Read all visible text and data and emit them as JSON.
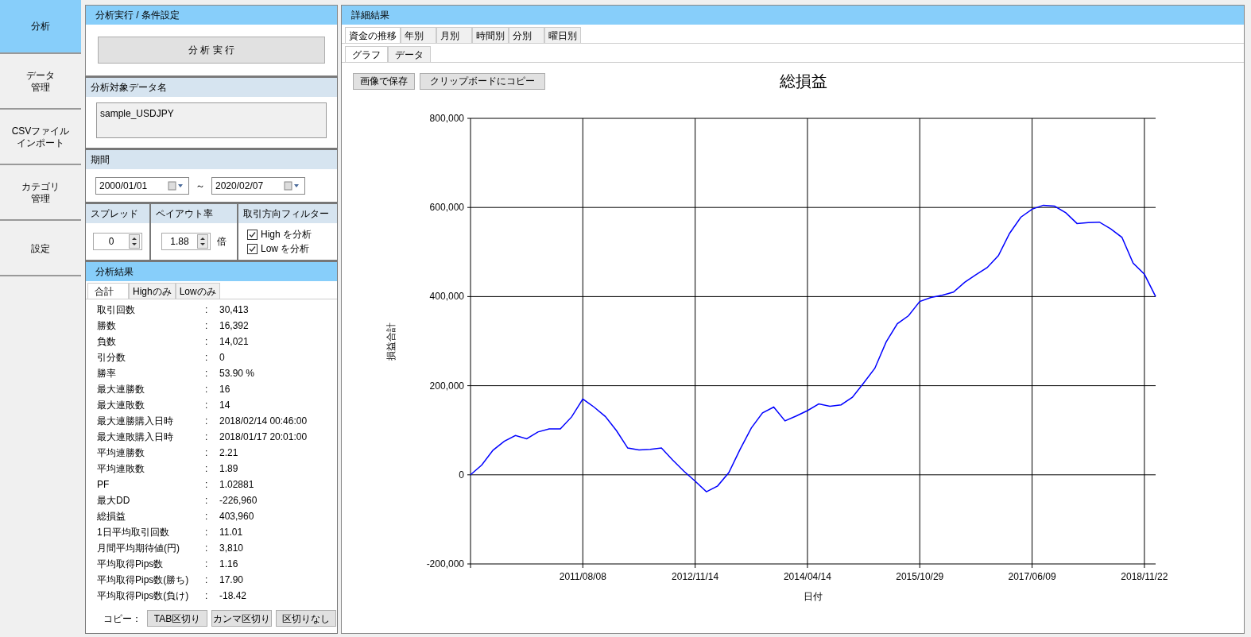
{
  "nav": [
    {
      "lines": [
        "分析"
      ],
      "selected": true
    },
    {
      "lines": [
        "データ",
        "管理"
      ],
      "selected": false
    },
    {
      "lines": [
        "CSVファイル",
        "インポート"
      ],
      "selected": false
    },
    {
      "lines": [
        "カテゴリ",
        "管理"
      ],
      "selected": false
    },
    {
      "lines": [
        "設定"
      ],
      "selected": false
    }
  ],
  "conditions": {
    "title": "分析実行 / 条件設定",
    "run_button": "分 析 実 行"
  },
  "data_name": {
    "title": "分析対象データ名",
    "value": "sample_USDJPY"
  },
  "period": {
    "title": "期間",
    "start": "2000/01/01",
    "separator": "～",
    "end": "2020/02/07"
  },
  "spread": {
    "title": "スプレッド",
    "value": "0"
  },
  "payout": {
    "title": "ペイアウト率",
    "value": "1.88",
    "unit": "倍"
  },
  "direction_filter": {
    "title": "取引方向フィルター",
    "options": [
      {
        "label": "High を分析",
        "checked": true
      },
      {
        "label": "Low を分析",
        "checked": true
      }
    ]
  },
  "results": {
    "title": "分析結果",
    "tabs": [
      {
        "label": "合計",
        "selected": true
      },
      {
        "label": "Highのみ",
        "selected": false
      },
      {
        "label": "Lowのみ",
        "selected": false
      }
    ],
    "rows": [
      {
        "label": "取引回数",
        "sep": ":",
        "value": "30,413"
      },
      {
        "label": "勝数",
        "sep": ":",
        "value": "16,392"
      },
      {
        "label": "負数",
        "sep": ":",
        "value": "14,021"
      },
      {
        "label": "引分数",
        "sep": ":",
        "value": "0"
      },
      {
        "label": "勝率",
        "sep": ":",
        "value": "53.90 %"
      },
      {
        "label": "最大連勝数",
        "sep": ":",
        "value": "16"
      },
      {
        "label": "最大連敗数",
        "sep": ":",
        "value": "14"
      },
      {
        "label": "最大連勝購入日時",
        "sep": ":",
        "value": "2018/02/14 00:46:00"
      },
      {
        "label": "最大連敗購入日時",
        "sep": ":",
        "value": "2018/01/17 20:01:00"
      },
      {
        "label": "平均連勝数",
        "sep": ":",
        "value": "2.21"
      },
      {
        "label": "平均連敗数",
        "sep": ":",
        "value": "1.89"
      },
      {
        "label": "PF",
        "sep": ":",
        "value": "1.02881"
      },
      {
        "label": "最大DD",
        "sep": ":",
        "value": "-226,960"
      },
      {
        "label": "総損益",
        "sep": ":",
        "value": "403,960"
      },
      {
        "label": "1日平均取引回数",
        "sep": ":",
        "value": "11.01"
      },
      {
        "label": "月間平均期待値(円)",
        "sep": ":",
        "value": "3,810"
      },
      {
        "label": "平均取得Pips数",
        "sep": ":",
        "value": "1.16"
      },
      {
        "label": "平均取得Pips数(勝ち)",
        "sep": ":",
        "value": "17.90"
      },
      {
        "label": "平均取得Pips数(負け)",
        "sep": ":",
        "value": "-18.42"
      }
    ],
    "copy_label": "コピー：",
    "copy_buttons": [
      "TAB区切り",
      "カンマ区切り",
      "区切りなし"
    ]
  },
  "details": {
    "title": "詳細結果",
    "tabs": [
      {
        "label": "資金の推移",
        "selected": true
      },
      {
        "label": "年別",
        "selected": false
      },
      {
        "label": "月別",
        "selected": false
      },
      {
        "label": "時間別",
        "selected": false
      },
      {
        "label": "分別",
        "selected": false
      },
      {
        "label": "曜日別",
        "selected": false
      }
    ],
    "subtabs": [
      {
        "label": "グラフ",
        "selected": true
      },
      {
        "label": "データ",
        "selected": false
      }
    ],
    "buttons": [
      "画像で保存",
      "クリップボードにコピー"
    ],
    "chart_data": {
      "type": "line",
      "title": "総損益",
      "xlabel": "日付",
      "ylabel": "損益合計",
      "grid": true,
      "ylim": [
        -200000,
        800000
      ],
      "yticks": [
        {
          "value": -200000,
          "label": "-200,000"
        },
        {
          "value": 0,
          "label": "0"
        },
        {
          "value": 200000,
          "label": "200,000"
        },
        {
          "value": 400000,
          "label": "400,000"
        },
        {
          "value": 600000,
          "label": "600,000"
        },
        {
          "value": 800000,
          "label": "800,000"
        }
      ],
      "categories": [
        null,
        null,
        null,
        null,
        null,
        null,
        null,
        null,
        null,
        null,
        "2011/08/08",
        null,
        null,
        null,
        null,
        null,
        null,
        null,
        null,
        null,
        "2012/11/14",
        null,
        null,
        null,
        null,
        null,
        null,
        null,
        null,
        null,
        "2014/04/14",
        null,
        null,
        null,
        null,
        null,
        null,
        null,
        null,
        null,
        "2015/10/29",
        null,
        null,
        null,
        null,
        null,
        null,
        null,
        null,
        null,
        "2017/06/09",
        null,
        null,
        null,
        null,
        null,
        null,
        null,
        null,
        null,
        "2018/11/22",
        null
      ],
      "series": [
        {
          "color": "#0000ff",
          "values": [
            0,
            22000,
            55000,
            75000,
            88000,
            81000,
            96000,
            103000,
            103000,
            130000,
            170000,
            152000,
            131000,
            99000,
            60000,
            56000,
            57000,
            60000,
            33000,
            8000,
            -14000,
            -38000,
            -25000,
            5000,
            57000,
            105000,
            139000,
            152000,
            121000,
            132000,
            144000,
            159000,
            154000,
            157000,
            174000,
            206000,
            239000,
            298000,
            339000,
            357000,
            389000,
            398000,
            403000,
            410000,
            432000,
            449000,
            465000,
            492000,
            542000,
            578000,
            596000,
            605000,
            603000,
            588000,
            564000,
            566000,
            567000,
            552000,
            533000,
            475000,
            450000,
            400000
          ]
        }
      ]
    }
  }
}
